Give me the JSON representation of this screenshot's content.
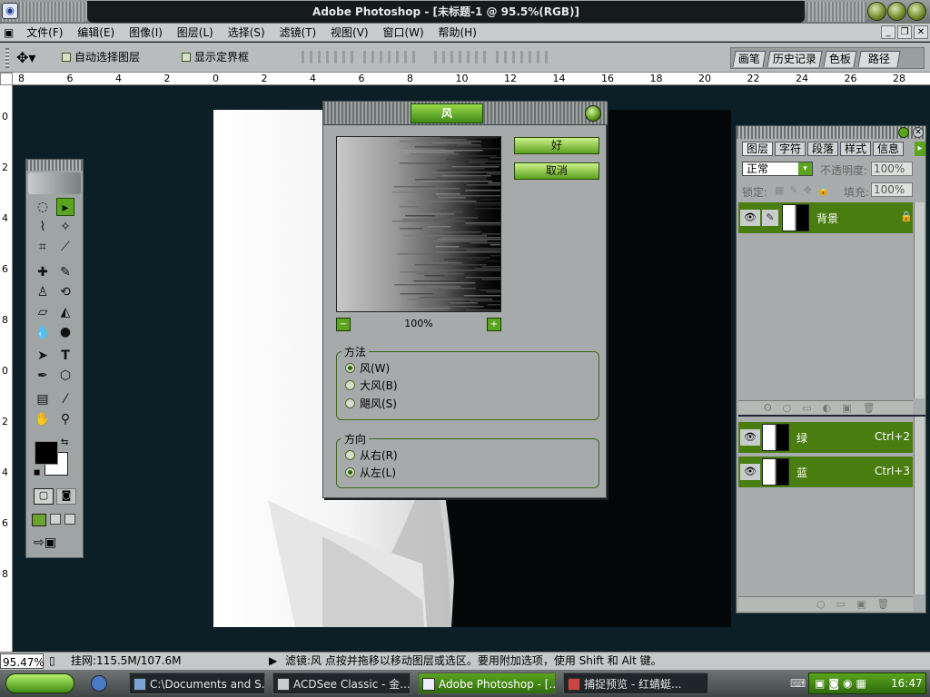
{
  "window": {
    "title": "Adobe Photoshop - [未标题-1 @ 95.5%(RGB)]"
  },
  "menu": [
    "文件(F)",
    "编辑(E)",
    "图像(I)",
    "图层(L)",
    "选择(S)",
    "滤镜(T)",
    "视图(V)",
    "窗口(W)",
    "帮助(H)"
  ],
  "options": {
    "auto_select": "自动选择图层",
    "show_bounds": "显示定界框"
  },
  "palette_well_tabs": [
    "画笔",
    "历史记录",
    "色板",
    "路径"
  ],
  "ruler": {
    "h_labels": [
      "8",
      "6",
      "4",
      "2",
      "0",
      "2",
      "4",
      "6",
      "8",
      "10",
      "12",
      "14",
      "16",
      "18",
      "20",
      "22",
      "24",
      "26",
      "28"
    ],
    "v_labels": [
      "0",
      "2",
      "4",
      "6",
      "8",
      "0",
      "2",
      "4",
      "6",
      "8"
    ]
  },
  "dialog": {
    "title": "风",
    "ok": "好",
    "cancel": "取消",
    "zoom": "100%",
    "method": {
      "label": "方法",
      "options": [
        "风(W)",
        "大风(B)",
        "飓风(S)"
      ],
      "selected": 0
    },
    "direction": {
      "label": "方向",
      "options": [
        "从右(R)",
        "从左(L)"
      ],
      "selected": 1
    }
  },
  "layers_panel": {
    "tabs": [
      "图层",
      "字符",
      "段落",
      "样式",
      "信息"
    ],
    "blend_mode": "正常",
    "opacity_label": "不透明度:",
    "opacity": "100%",
    "lock_label": "锁定:",
    "fill_label": "填充:",
    "fill": "100%",
    "layer": {
      "name": "背景"
    },
    "channels": [
      {
        "name": "绿",
        "shortcut": "Ctrl+2"
      },
      {
        "name": "蓝",
        "shortcut": "Ctrl+3"
      }
    ]
  },
  "status": {
    "zoom": "95.47%",
    "doc": "挂网:115.5M/107.6M",
    "hint": "滤镜:风  点按并拖移以移动图层或选区。要用附加选项，使用 Shift 和 Alt 键。"
  },
  "taskbar": {
    "tasks": [
      {
        "label": "C:\\Documents and S...",
        "active": false
      },
      {
        "label": "ACDSee Classic - 金...",
        "active": false
      },
      {
        "label": "Adobe Photoshop - [...",
        "active": true
      },
      {
        "label": "捕捉预览 - 红蜻蜓...",
        "active": false
      }
    ],
    "clock": "16:47"
  }
}
